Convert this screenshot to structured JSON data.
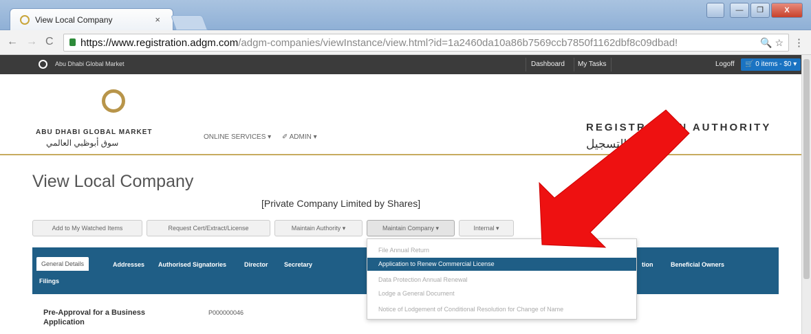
{
  "browser": {
    "tab_title": "View Local Company",
    "tab_close": "×",
    "url_host": "https://www.registration.adgm.com",
    "url_path": "/adgm-companies/viewInstance/view.html?id=1a2460da10a86b7569ccb7850f1162dbf8c09dbad!",
    "back": "←",
    "forward": "→",
    "reload": "C",
    "omni_icons": "🔍 ☆",
    "menu": "⋮",
    "window_controls": {
      "min": "—",
      "max": "❐",
      "close": "X"
    }
  },
  "site_bar": {
    "site_name": "Abu Dhabi Global Market",
    "dashboard": "Dashboard",
    "my_tasks": "My Tasks",
    "logoff": "Logoff",
    "cart": "🛒 0 items - $0 ▾"
  },
  "header": {
    "brand_en": "ABU DHABI GLOBAL MARKET",
    "brand_ar": "سوق أبوظبي العالمي",
    "nav_online": "ONLINE SERVICES ▾",
    "nav_admin": "✐ ADMIN ▾",
    "authority_en": "REGISTRATION AUTHORITY",
    "authority_ar": "سلطة التسجيل"
  },
  "page": {
    "title": "View Local Company",
    "subtitle": "[Private Company Limited by Shares]"
  },
  "actions": [
    "Add to My Watched Items",
    "Request Cert/Extract/License",
    "Maintain Authority ▾",
    "Maintain Company ▾",
    "Internal ▾"
  ],
  "tabs": {
    "general": "General Details",
    "addresses": "Addresses",
    "signatories": "Authorised Signatories",
    "director": "Director",
    "secretary": "Secretary",
    "tion": "tion",
    "beneficial": "Beneficial Owners",
    "filings": "Filings"
  },
  "details": {
    "label": "Pre-Approval for a Business Application",
    "value": "P000000046"
  },
  "dropdown": [
    "File Annual Return",
    "Application to Renew Commercial License",
    "Data Protection Annual Renewal",
    "Lodge a General Document",
    "Notice of Lodgement of Conditional Resolution for Change of Name"
  ],
  "colors": {
    "brand_blue": "#1f5e86",
    "gold": "#b8954a",
    "annotation_red": "#ee1111"
  }
}
